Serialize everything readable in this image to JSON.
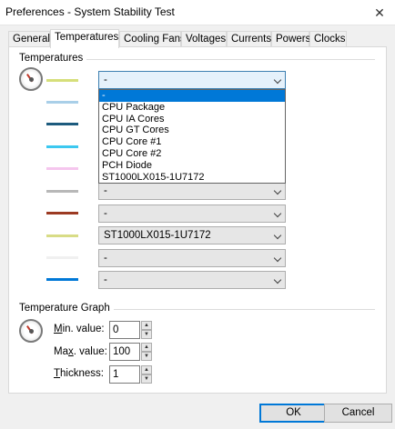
{
  "window": {
    "title": "Preferences - System Stability Test",
    "close_glyph": "✕"
  },
  "tabs": [
    {
      "label": "General"
    },
    {
      "label": "Temperatures",
      "active": true
    },
    {
      "label": "Cooling Fans"
    },
    {
      "label": "Voltages"
    },
    {
      "label": "Currents"
    },
    {
      "label": "Powers"
    },
    {
      "label": "Clocks"
    }
  ],
  "temperatures": {
    "group_label": "Temperatures",
    "rows": [
      {
        "color": "#d6df7a",
        "value": "-"
      },
      {
        "color": "#a9cfe8",
        "value": "-"
      },
      {
        "color": "#1d5b7e",
        "value": "-"
      },
      {
        "color": "#3cc8f0",
        "value": "-"
      },
      {
        "color": "#f5c6ee",
        "value": "-"
      },
      {
        "color": "#b8b8b8",
        "value": "-"
      },
      {
        "color": "#9c3a22",
        "value": "-"
      },
      {
        "color": "#d8dc86",
        "value": "ST1000LX015-1U7172"
      },
      {
        "color": "#f0f0f0",
        "value": "-"
      },
      {
        "color": "#0078d7",
        "value": "-"
      }
    ],
    "dropdown_options": [
      "-",
      "CPU Package",
      "CPU IA Cores",
      "CPU GT Cores",
      "CPU Core #1",
      "CPU Core #2",
      "PCH Diode",
      "ST1000LX015-1U7172"
    ],
    "dropdown_selected": "-"
  },
  "graph": {
    "group_label": "Temperature Graph",
    "min": {
      "label_u": "M",
      "label_rest": "in. value:",
      "value": "0"
    },
    "max": {
      "label_pre": "Ma",
      "label_u": "x",
      "label_rest": ". value:",
      "value": "100"
    },
    "thickness": {
      "label_u": "T",
      "label_rest": "hickness:",
      "value": "1"
    }
  },
  "buttons": {
    "ok": "OK",
    "cancel": "Cancel"
  }
}
